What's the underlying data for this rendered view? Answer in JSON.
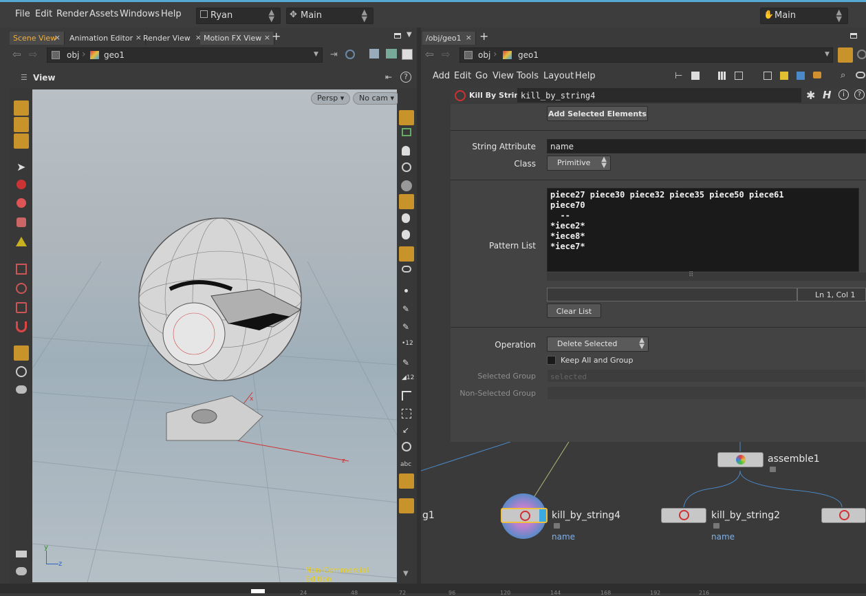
{
  "menubar": {
    "file": "File",
    "edit": "Edit",
    "render": "Render",
    "assets": "Assets",
    "windows": "Windows",
    "help": "Help",
    "desktop": "Ryan",
    "context": "Main",
    "right_context": "Main"
  },
  "left_tabs": [
    {
      "label": "Scene View"
    },
    {
      "label": "Animation Editor"
    },
    {
      "label": "Render View"
    },
    {
      "label": "Motion FX View"
    }
  ],
  "left_path": {
    "root": "obj",
    "node": "geo1"
  },
  "viewport": {
    "title": "View",
    "persp_label": "Persp",
    "cam_label": "No cam",
    "watermark": "Non-Commercial Edition",
    "axis_x": "x",
    "axis_y": "y",
    "axis_z": "z",
    "grid_z": "z",
    "grid_x": "x"
  },
  "right_tabs": [
    {
      "label": "/obj/geo1"
    }
  ],
  "right_path": {
    "root": "obj",
    "node": "geo1"
  },
  "net_menu": {
    "add": "Add",
    "edit": "Edit",
    "go": "Go",
    "view": "View",
    "tools": "Tools",
    "layout": "Layout",
    "help": "Help"
  },
  "parm": {
    "node_type": "Kill By String",
    "node_name": "kill_by_string4",
    "add_selected_label": "Add Selected Elements",
    "string_attr_label": "String Attribute",
    "string_attr_value": "name",
    "class_label": "Class",
    "class_value": "Primitive",
    "pattern_label": "Pattern List",
    "pattern_lines": [
      "piece27 piece30 piece32 piece35 piece50 piece61",
      "piece70",
      "  --",
      "*iece2*",
      "*iece8*",
      "*iece7*"
    ],
    "cursor_pos": "Ln 1, Col 1",
    "clear_list_label": "Clear List",
    "operation_label": "Operation",
    "operation_value": "Delete Selected",
    "keep_all_label": "Keep All and Group",
    "selected_group_label": "Selected Group",
    "selected_group_placeholder": "selected",
    "non_selected_group_label": "Non-Selected Group"
  },
  "network": {
    "nodes": [
      {
        "name": "assemble1",
        "sub": ""
      },
      {
        "name": "kill_by_string4",
        "sub": "name"
      },
      {
        "name": "kill_by_string2",
        "sub": "name"
      },
      {
        "name": "g1",
        "sub": ""
      }
    ]
  },
  "timeline": {
    "ticks": [
      "24",
      "48",
      "72",
      "96",
      "120",
      "144",
      "168",
      "192",
      "216"
    ]
  },
  "colors": {
    "accent": "#c8932a",
    "link": "#7eb0e8",
    "selected_node": "#f0c040",
    "watermark": "#e8d020"
  }
}
